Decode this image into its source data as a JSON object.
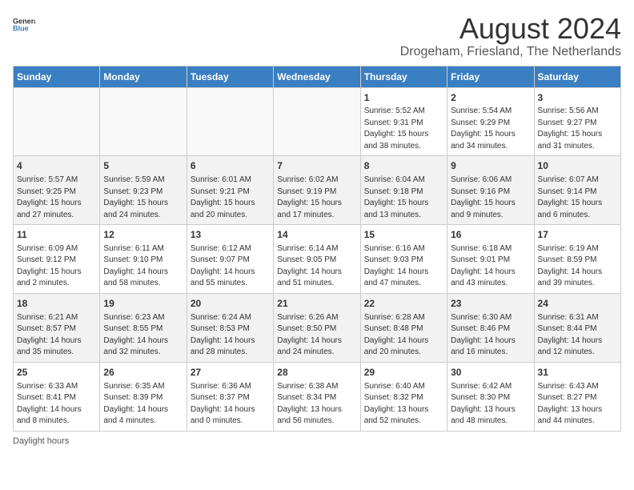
{
  "logo": {
    "text_general": "General",
    "text_blue": "Blue"
  },
  "title": "August 2024",
  "subtitle": "Drogeham, Friesland, The Netherlands",
  "days_of_week": [
    "Sunday",
    "Monday",
    "Tuesday",
    "Wednesday",
    "Thursday",
    "Friday",
    "Saturday"
  ],
  "weeks": [
    [
      {
        "day": "",
        "info": ""
      },
      {
        "day": "",
        "info": ""
      },
      {
        "day": "",
        "info": ""
      },
      {
        "day": "",
        "info": ""
      },
      {
        "day": "1",
        "info": "Sunrise: 5:52 AM\nSunset: 9:31 PM\nDaylight: 15 hours\nand 38 minutes."
      },
      {
        "day": "2",
        "info": "Sunrise: 5:54 AM\nSunset: 9:29 PM\nDaylight: 15 hours\nand 34 minutes."
      },
      {
        "day": "3",
        "info": "Sunrise: 5:56 AM\nSunset: 9:27 PM\nDaylight: 15 hours\nand 31 minutes."
      }
    ],
    [
      {
        "day": "4",
        "info": "Sunrise: 5:57 AM\nSunset: 9:25 PM\nDaylight: 15 hours\nand 27 minutes."
      },
      {
        "day": "5",
        "info": "Sunrise: 5:59 AM\nSunset: 9:23 PM\nDaylight: 15 hours\nand 24 minutes."
      },
      {
        "day": "6",
        "info": "Sunrise: 6:01 AM\nSunset: 9:21 PM\nDaylight: 15 hours\nand 20 minutes."
      },
      {
        "day": "7",
        "info": "Sunrise: 6:02 AM\nSunset: 9:19 PM\nDaylight: 15 hours\nand 17 minutes."
      },
      {
        "day": "8",
        "info": "Sunrise: 6:04 AM\nSunset: 9:18 PM\nDaylight: 15 hours\nand 13 minutes."
      },
      {
        "day": "9",
        "info": "Sunrise: 6:06 AM\nSunset: 9:16 PM\nDaylight: 15 hours\nand 9 minutes."
      },
      {
        "day": "10",
        "info": "Sunrise: 6:07 AM\nSunset: 9:14 PM\nDaylight: 15 hours\nand 6 minutes."
      }
    ],
    [
      {
        "day": "11",
        "info": "Sunrise: 6:09 AM\nSunset: 9:12 PM\nDaylight: 15 hours\nand 2 minutes."
      },
      {
        "day": "12",
        "info": "Sunrise: 6:11 AM\nSunset: 9:10 PM\nDaylight: 14 hours\nand 58 minutes."
      },
      {
        "day": "13",
        "info": "Sunrise: 6:12 AM\nSunset: 9:07 PM\nDaylight: 14 hours\nand 55 minutes."
      },
      {
        "day": "14",
        "info": "Sunrise: 6:14 AM\nSunset: 9:05 PM\nDaylight: 14 hours\nand 51 minutes."
      },
      {
        "day": "15",
        "info": "Sunrise: 6:16 AM\nSunset: 9:03 PM\nDaylight: 14 hours\nand 47 minutes."
      },
      {
        "day": "16",
        "info": "Sunrise: 6:18 AM\nSunset: 9:01 PM\nDaylight: 14 hours\nand 43 minutes."
      },
      {
        "day": "17",
        "info": "Sunrise: 6:19 AM\nSunset: 8:59 PM\nDaylight: 14 hours\nand 39 minutes."
      }
    ],
    [
      {
        "day": "18",
        "info": "Sunrise: 6:21 AM\nSunset: 8:57 PM\nDaylight: 14 hours\nand 35 minutes."
      },
      {
        "day": "19",
        "info": "Sunrise: 6:23 AM\nSunset: 8:55 PM\nDaylight: 14 hours\nand 32 minutes."
      },
      {
        "day": "20",
        "info": "Sunrise: 6:24 AM\nSunset: 8:53 PM\nDaylight: 14 hours\nand 28 minutes."
      },
      {
        "day": "21",
        "info": "Sunrise: 6:26 AM\nSunset: 8:50 PM\nDaylight: 14 hours\nand 24 minutes."
      },
      {
        "day": "22",
        "info": "Sunrise: 6:28 AM\nSunset: 8:48 PM\nDaylight: 14 hours\nand 20 minutes."
      },
      {
        "day": "23",
        "info": "Sunrise: 6:30 AM\nSunset: 8:46 PM\nDaylight: 14 hours\nand 16 minutes."
      },
      {
        "day": "24",
        "info": "Sunrise: 6:31 AM\nSunset: 8:44 PM\nDaylight: 14 hours\nand 12 minutes."
      }
    ],
    [
      {
        "day": "25",
        "info": "Sunrise: 6:33 AM\nSunset: 8:41 PM\nDaylight: 14 hours\nand 8 minutes."
      },
      {
        "day": "26",
        "info": "Sunrise: 6:35 AM\nSunset: 8:39 PM\nDaylight: 14 hours\nand 4 minutes."
      },
      {
        "day": "27",
        "info": "Sunrise: 6:36 AM\nSunset: 8:37 PM\nDaylight: 14 hours\nand 0 minutes."
      },
      {
        "day": "28",
        "info": "Sunrise: 6:38 AM\nSunset: 8:34 PM\nDaylight: 13 hours\nand 56 minutes."
      },
      {
        "day": "29",
        "info": "Sunrise: 6:40 AM\nSunset: 8:32 PM\nDaylight: 13 hours\nand 52 minutes."
      },
      {
        "day": "30",
        "info": "Sunrise: 6:42 AM\nSunset: 8:30 PM\nDaylight: 13 hours\nand 48 minutes."
      },
      {
        "day": "31",
        "info": "Sunrise: 6:43 AM\nSunset: 8:27 PM\nDaylight: 13 hours\nand 44 minutes."
      }
    ]
  ],
  "footer": {
    "daylight_label": "Daylight hours"
  }
}
